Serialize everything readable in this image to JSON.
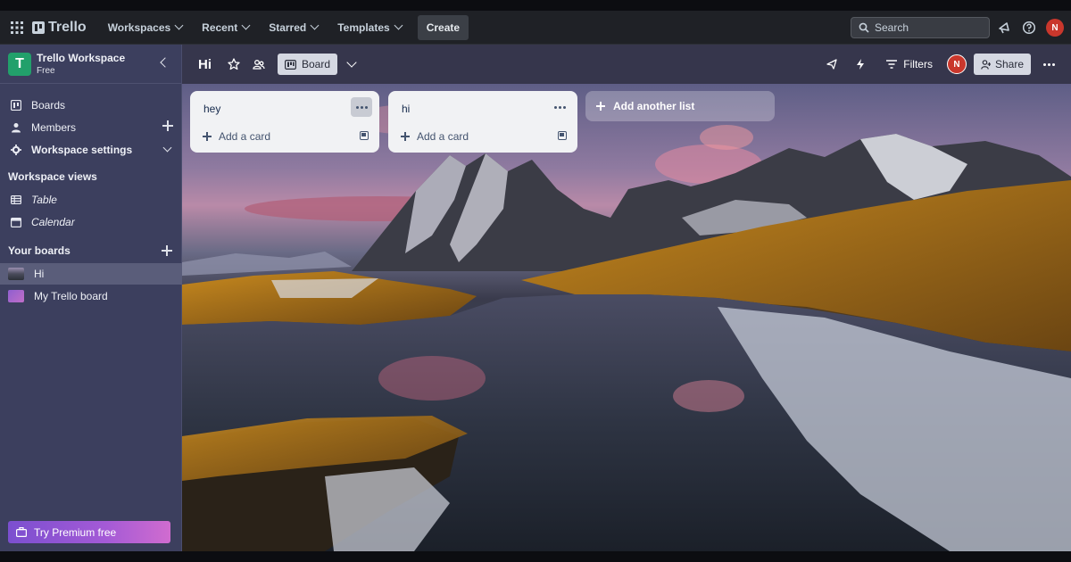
{
  "nav": {
    "logo_text": "Trello",
    "menu": [
      {
        "label": "Workspaces"
      },
      {
        "label": "Recent"
      },
      {
        "label": "Starred"
      },
      {
        "label": "Templates"
      }
    ],
    "create_label": "Create",
    "search_placeholder": "Search",
    "avatar_initial": "N"
  },
  "sidebar": {
    "workspace_initial": "T",
    "workspace_name": "Trello Workspace",
    "workspace_plan": "Free",
    "items": [
      {
        "label": "Boards"
      },
      {
        "label": "Members"
      },
      {
        "label": "Workspace settings"
      }
    ],
    "views_heading": "Workspace views",
    "views": [
      {
        "label": "Table"
      },
      {
        "label": "Calendar"
      }
    ],
    "boards_heading": "Your boards",
    "boards": [
      {
        "label": "Hi",
        "selected": true
      },
      {
        "label": "My Trello board",
        "selected": false
      }
    ],
    "premium_label": "Try Premium free"
  },
  "board": {
    "title": "Hi",
    "view_label": "Board",
    "filters_label": "Filters",
    "member_initial": "N",
    "share_label": "Share",
    "lists": [
      {
        "title": "hey",
        "add_card_label": "Add a card"
      },
      {
        "title": "hi",
        "add_card_label": "Add a card"
      }
    ],
    "add_list_label": "Add another list"
  },
  "colors": {
    "nav_bg": "#1f2126",
    "sidebar_bg": "#3c3f5e",
    "workspace_badge": "#22a06b",
    "avatar": "#c9372c",
    "list_bg": "#f1f2f4"
  },
  "icons": [
    "apps-grid-icon",
    "trello-logo-icon",
    "search-icon",
    "megaphone-icon",
    "help-icon",
    "star-icon",
    "visibility-icon",
    "board-icon",
    "power-up-icon",
    "automation-icon",
    "filter-icon",
    "share-person-icon",
    "more-icon",
    "briefcase-icon"
  ]
}
